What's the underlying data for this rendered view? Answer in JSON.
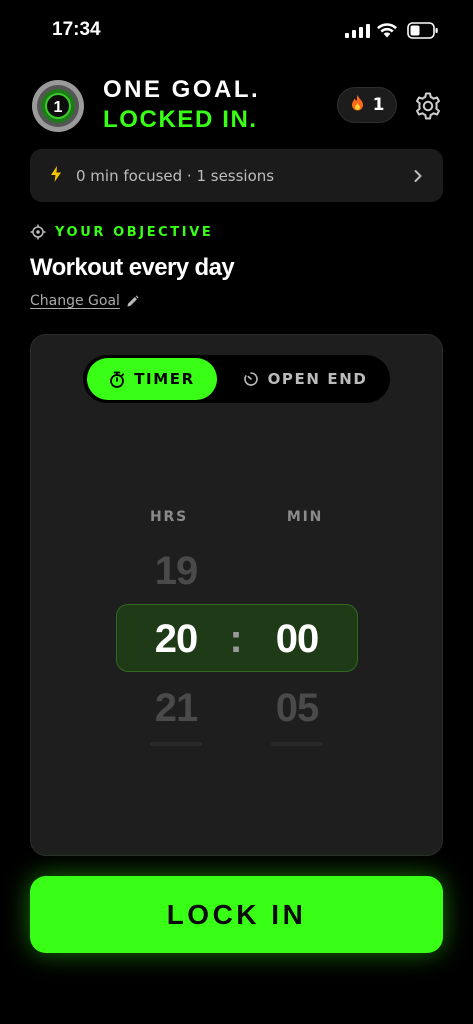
{
  "status_bar": {
    "time": "17:34"
  },
  "header": {
    "title_line1": "ONE GOAL.",
    "title_line2": "LOCKED IN.",
    "logo_number": "1",
    "streak_count": "1"
  },
  "stats": {
    "text": "0 min focused · 1 sessions"
  },
  "objective": {
    "label": "YOUR OBJECTIVE",
    "goal": "Workout every day",
    "change_label": "Change Goal"
  },
  "timer_card": {
    "modes": [
      {
        "label": "TIMER",
        "selected": true
      },
      {
        "label": "OPEN END",
        "selected": false
      }
    ],
    "hours_label": "HRS",
    "minutes_label": "MIN",
    "hours_prev": "19",
    "hours_selected": "20",
    "hours_next": "21",
    "minutes_selected": "00",
    "minutes_next": "05",
    "separator": ":"
  },
  "lock_button": {
    "label": "LOCK IN"
  },
  "colors": {
    "accent": "#38ff15",
    "background": "#000000",
    "card": "#1e1e1e"
  }
}
